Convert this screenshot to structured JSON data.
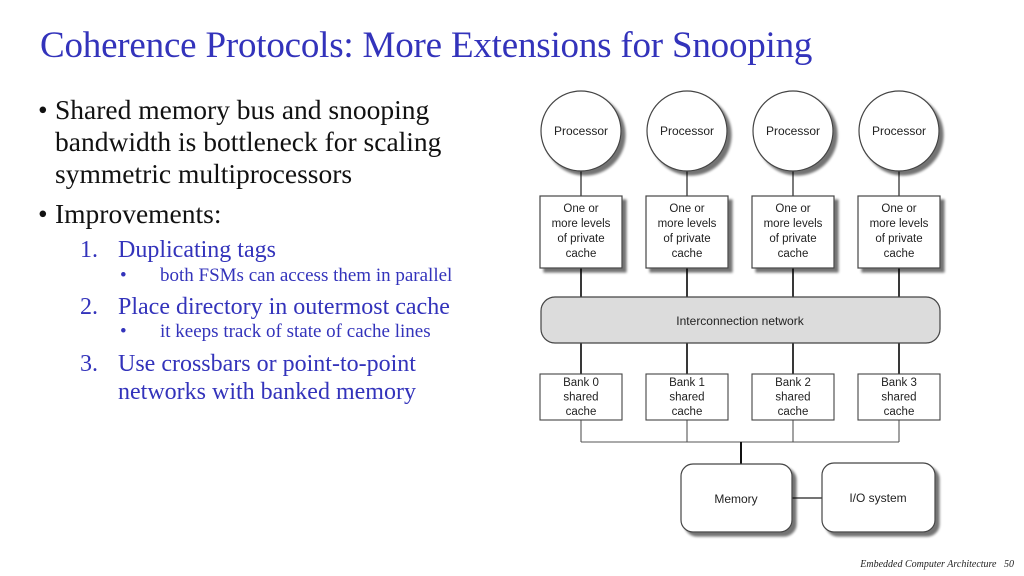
{
  "slide": {
    "title": "Coherence Protocols:  More Extensions for Snooping",
    "bullets": [
      {
        "marker": "•",
        "lines": [
          "Shared memory bus and snooping",
          "bandwidth is bottleneck for scaling",
          "symmetric multiprocessors"
        ]
      },
      {
        "marker": "•",
        "lines": [
          "Improvements:"
        ]
      }
    ],
    "improvements": [
      {
        "number": "1.",
        "lines": [
          "Duplicating tags"
        ],
        "sub": {
          "marker": "•",
          "text": "both FSMs can access them in parallel"
        }
      },
      {
        "number": "2.",
        "lines": [
          "Place directory in outermost cache"
        ],
        "sub": {
          "marker": "•",
          "text": "it keeps track of state of cache lines"
        }
      },
      {
        "number": "3.",
        "lines": [
          "Use crossbars or point-to-point",
          "networks with banked memory"
        ]
      }
    ],
    "footer": {
      "course": "Embedded Computer Architecture",
      "page": "50"
    },
    "colors": {
      "title": "#3333bb",
      "body": "#111111",
      "accent_list": "#3333bb",
      "network_fill": "#dcdcdc"
    }
  },
  "diagram": {
    "processors": [
      {
        "label": "Processor"
      },
      {
        "label": "Processor"
      },
      {
        "label": "Processor"
      },
      {
        "label": "Processor"
      }
    ],
    "private_caches": [
      {
        "lines": [
          "One or",
          "more levels",
          "of private",
          "cache"
        ]
      },
      {
        "lines": [
          "One or",
          "more levels",
          "of private",
          "cache"
        ]
      },
      {
        "lines": [
          "One or",
          "more levels",
          "of private",
          "cache"
        ]
      },
      {
        "lines": [
          "One or",
          "more levels",
          "of private",
          "cache"
        ]
      }
    ],
    "network": {
      "label": "Interconnection network"
    },
    "banks": [
      {
        "lines": [
          "Bank 0",
          "shared",
          "cache"
        ]
      },
      {
        "lines": [
          "Bank 1",
          "shared",
          "cache"
        ]
      },
      {
        "lines": [
          "Bank 2",
          "shared",
          "cache"
        ]
      },
      {
        "lines": [
          "Bank 3",
          "shared",
          "cache"
        ]
      }
    ],
    "memory": {
      "label": "Memory"
    },
    "io": {
      "label": "I/O system"
    }
  }
}
